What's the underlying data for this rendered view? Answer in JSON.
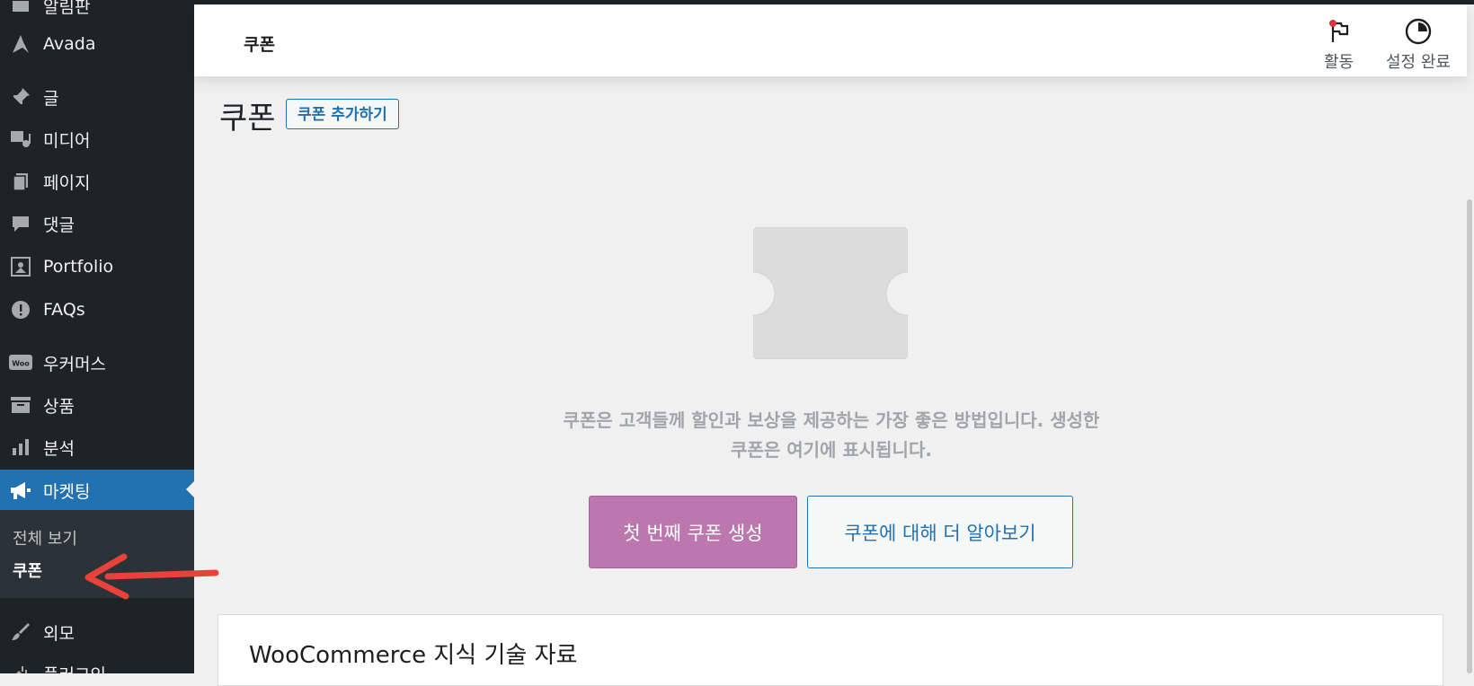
{
  "sidebar": {
    "items": [
      {
        "label": "알림판",
        "icon": "dashboard-icon"
      },
      {
        "label": "Avada",
        "icon": "avada-icon"
      },
      {
        "label": "글",
        "icon": "pin-icon"
      },
      {
        "label": "미디어",
        "icon": "media-icon"
      },
      {
        "label": "페이지",
        "icon": "pages-icon"
      },
      {
        "label": "댓글",
        "icon": "comment-icon"
      },
      {
        "label": "Portfolio",
        "icon": "portfolio-icon"
      },
      {
        "label": "FAQs",
        "icon": "info-icon"
      },
      {
        "label": "우커머스",
        "icon": "woo-icon"
      },
      {
        "label": "상품",
        "icon": "archive-icon"
      },
      {
        "label": "분석",
        "icon": "chart-bar-icon"
      },
      {
        "label": "마켓팅",
        "icon": "megaphone-icon"
      },
      {
        "label": "외모",
        "icon": "brush-icon"
      },
      {
        "label": "플러그인",
        "icon": "plugin-icon"
      }
    ],
    "submenu": [
      {
        "label": "전체 보기"
      },
      {
        "label": "쿠폰"
      }
    ]
  },
  "header": {
    "title": "쿠폰",
    "activity_label": "활동",
    "setup_label": "설정 완료"
  },
  "page": {
    "heading": "쿠폰",
    "add_button": "쿠폰 추가하기"
  },
  "empty_state": {
    "message_line1": "쿠폰은 고객들께 할인과 보상을 제공하는 가장 좋은 방법입니다. 생성한",
    "message_line2": "쿠폰은 여기에 표시됩니다.",
    "primary_button": "첫 번째 쿠폰 생성",
    "secondary_button": "쿠폰에 대해 더 알아보기"
  },
  "knowledge": {
    "title": "WooCommerce 지식 기술 자료"
  },
  "colors": {
    "sidebar_bg": "#1d2327",
    "active_bg": "#2271b1",
    "woo_purple": "#bb77ae",
    "link_blue": "#2271b1",
    "arrow_red": "#e8423a"
  }
}
